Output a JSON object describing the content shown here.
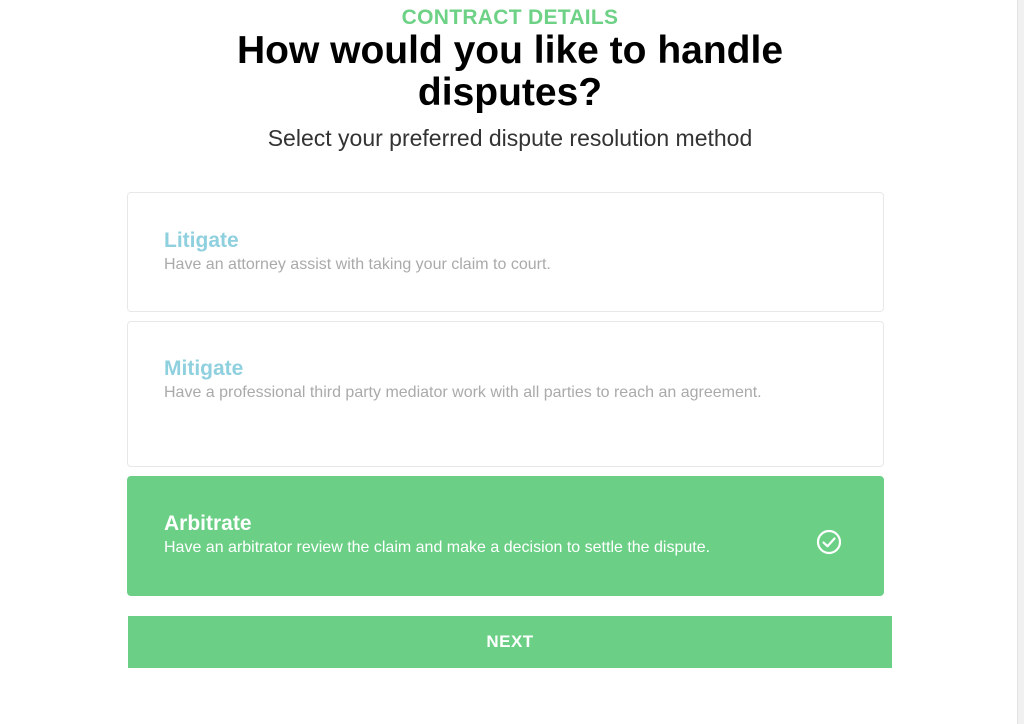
{
  "header": {
    "eyebrow": "CONTRACT DETAILS",
    "title": "How would you like to handle disputes?",
    "subtitle": "Select your preferred dispute resolution method"
  },
  "options": [
    {
      "title": "Litigate",
      "description": "Have an attorney assist with taking your claim to court.",
      "selected": false
    },
    {
      "title": "Mitigate",
      "description": "Have a professional third party mediator work with all parties to reach an agreement.",
      "selected": false
    },
    {
      "title": "Arbitrate",
      "description": "Have an arbitrator review the claim and make a decision to settle the dispute.",
      "selected": true,
      "icon": "check-circle-icon"
    }
  ],
  "actions": {
    "next_label": "NEXT"
  },
  "colors": {
    "accent": "#6bd086",
    "option_title": "#8fd0df",
    "option_desc": "#aaaaaa"
  }
}
